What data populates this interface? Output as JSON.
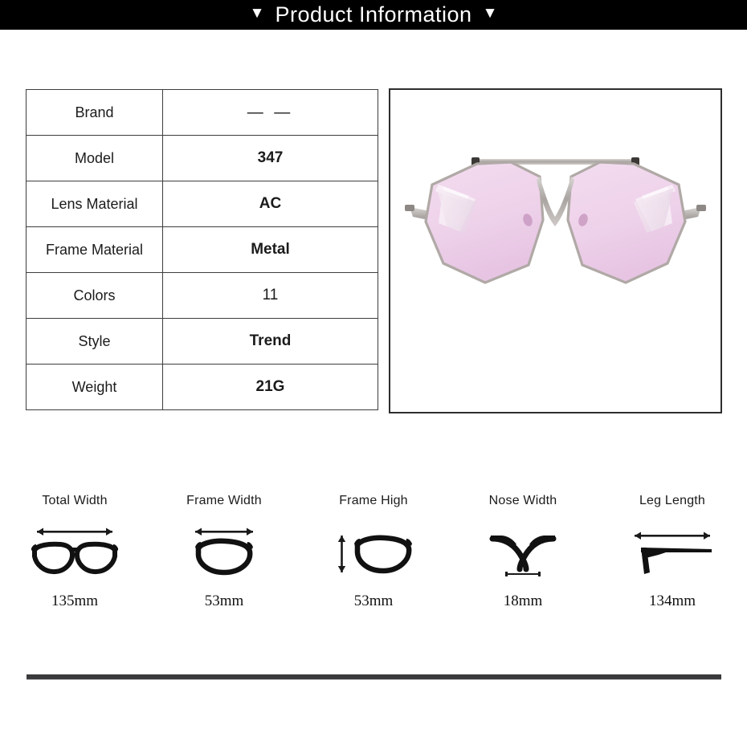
{
  "header": {
    "title": "Product Information",
    "caret_left": "▼",
    "caret_right": "▼",
    "background": "#000000",
    "text_color": "#ffffff"
  },
  "spec_table": {
    "rows": [
      {
        "label": "Brand",
        "value": "— —",
        "bold": false
      },
      {
        "label": "Model",
        "value": "347",
        "bold": true
      },
      {
        "label": "Lens Material",
        "value": "AC",
        "bold": true
      },
      {
        "label": "Frame Material",
        "value": "Metal",
        "bold": true
      },
      {
        "label": "Colors",
        "value": "11",
        "bold": false
      },
      {
        "label": "Style",
        "value": "Trend",
        "bold": true
      },
      {
        "label": "Weight",
        "value": "21G",
        "bold": true
      }
    ]
  },
  "product_photo": {
    "alt": "pink octagonal aviator sunglasses with silver metal frame",
    "lens_color": "#eed2ea",
    "lens_color_edge": "#e3bede",
    "frame_color": "#b9b3b0",
    "frame_highlight": "#ffffff",
    "background": "#ffffff",
    "border_color": "#2e2e2e"
  },
  "measurements": [
    {
      "label": "Total Width",
      "value": "135mm",
      "icon": "glasses-front-icon",
      "arrow": "horizontal"
    },
    {
      "label": "Frame Width",
      "value": "53mm",
      "icon": "single-lens-icon",
      "arrow": "horizontal"
    },
    {
      "label": "Frame High",
      "value": "53mm",
      "icon": "single-lens-height-icon",
      "arrow": "vertical"
    },
    {
      "label": "Nose Width",
      "value": "18mm",
      "icon": "nose-bridge-icon",
      "arrow": "horizontal-small"
    },
    {
      "label": "Leg Length",
      "value": "134mm",
      "icon": "temple-arm-icon",
      "arrow": "horizontal"
    }
  ],
  "divider": {
    "color": "#3a3a3d"
  }
}
